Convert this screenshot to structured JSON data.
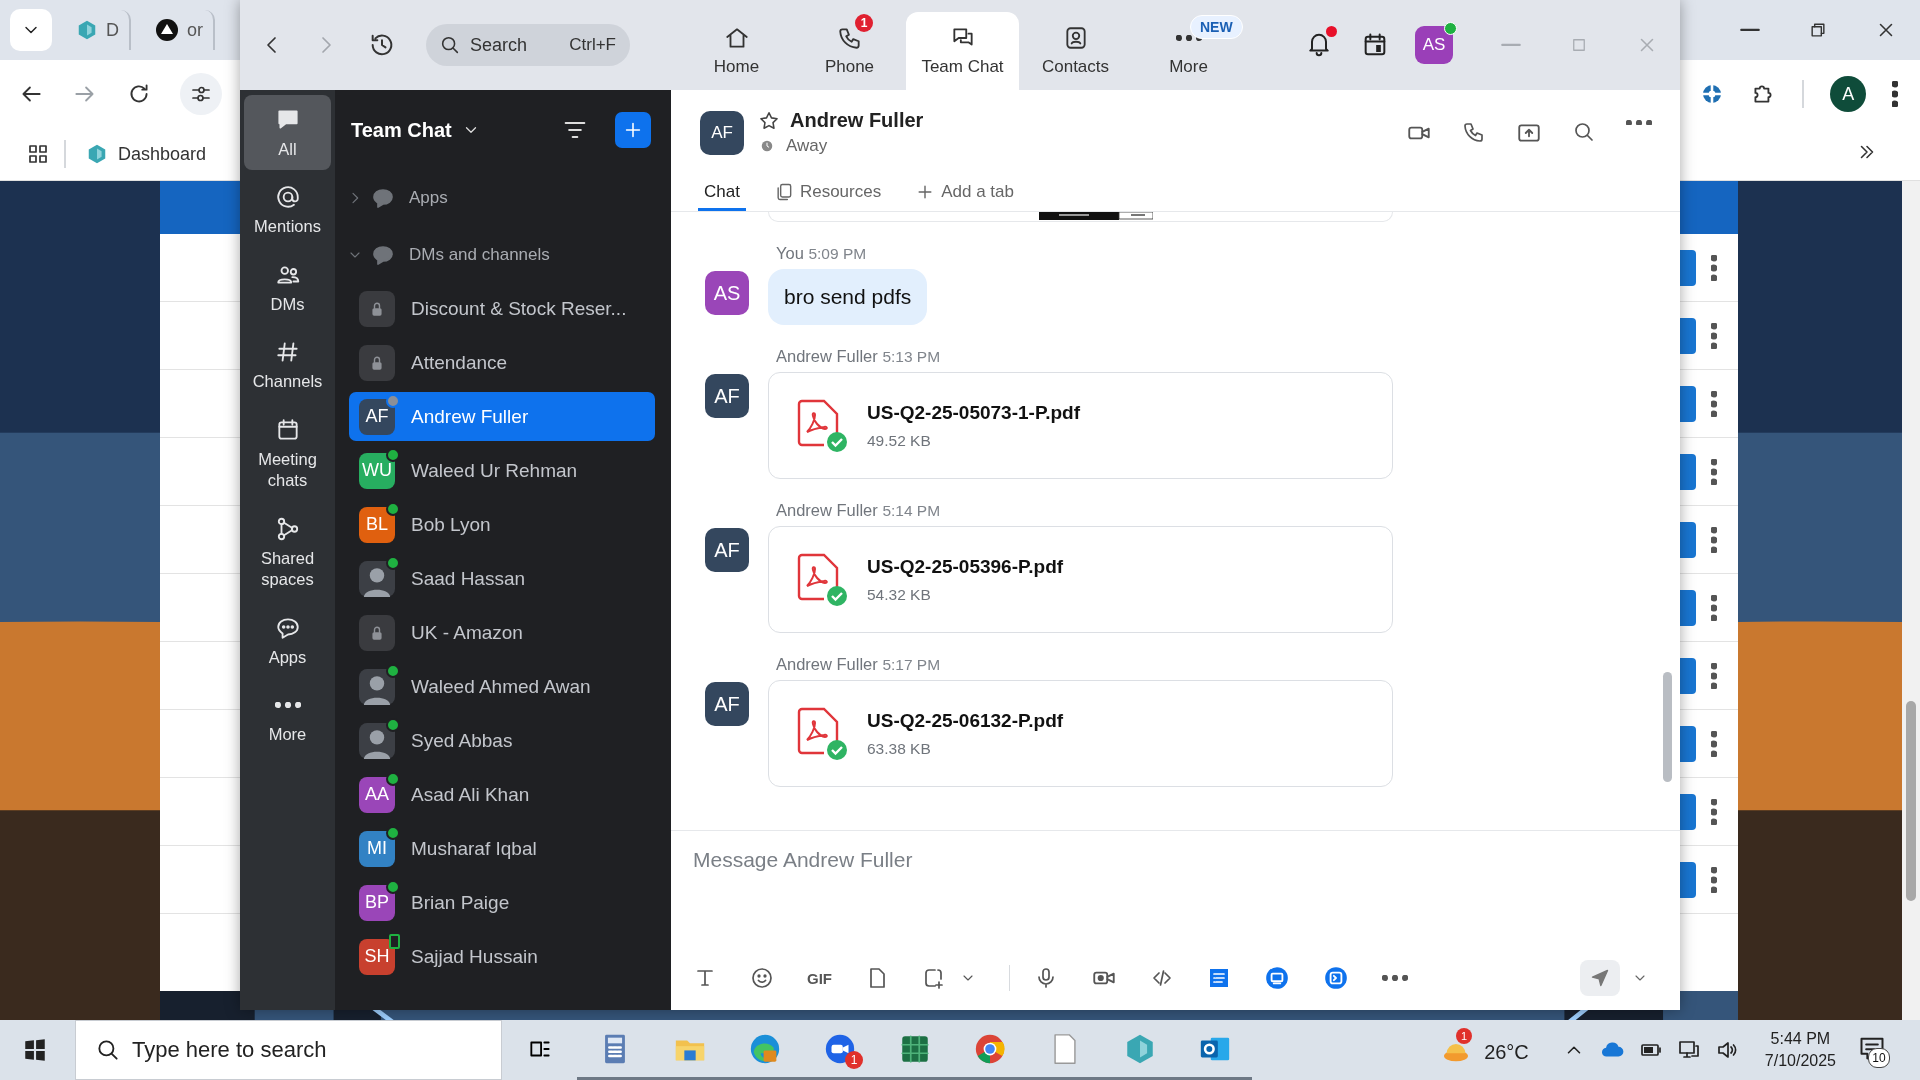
{
  "browser": {
    "tabs": [
      {
        "label": "D",
        "selected": false
      },
      {
        "label": "or",
        "selected": false
      }
    ],
    "bookmarks": [
      {
        "label": "Dashboard"
      }
    ],
    "profile": "A"
  },
  "zoom": {
    "search": {
      "placeholder": "Search",
      "shortcut": "Ctrl+F"
    },
    "tabs": [
      {
        "label": "Home",
        "selected": false
      },
      {
        "label": "Phone",
        "badge": "1",
        "selected": false
      },
      {
        "label": "Team Chat",
        "selected": true
      },
      {
        "label": "Contacts",
        "selected": false
      },
      {
        "label": "More",
        "tag": "NEW",
        "selected": false
      }
    ],
    "notifications": {
      "unread": true
    },
    "user": {
      "initials": "AS",
      "online": true
    },
    "rail": [
      {
        "label": "All",
        "selected": true
      },
      {
        "label": "Mentions",
        "selected": false
      },
      {
        "label": "DMs",
        "selected": false
      },
      {
        "label": "Channels",
        "selected": false
      },
      {
        "label": "Meeting chats",
        "selected": false
      },
      {
        "label": "Shared spaces",
        "selected": false
      },
      {
        "label": "Apps",
        "selected": false
      },
      {
        "label": "More",
        "selected": false
      }
    ],
    "sidebar": {
      "title": "Team Chat",
      "sections": [
        {
          "label": "Apps",
          "expanded": false
        },
        {
          "label": "DMs and channels",
          "expanded": true,
          "children": [
            {
              "kind": "channel",
              "name": "Discount & Stock Reser...",
              "online": false,
              "away": false,
              "mobile": false,
              "selected": false
            },
            {
              "kind": "channel",
              "name": "Attendance",
              "online": false,
              "away": false,
              "mobile": false,
              "selected": false
            },
            {
              "kind": "person",
              "name": "Andrew Fuller",
              "initials": "AF",
              "color": "#34475e",
              "online": false,
              "away": true,
              "mobile": false,
              "selected": true
            },
            {
              "kind": "person",
              "name": "Waleed Ur Rehman",
              "initials": "WU",
              "color": "#27ae60",
              "online": true,
              "away": false,
              "mobile": false,
              "selected": false
            },
            {
              "kind": "person",
              "name": "Bob Lyon",
              "initials": "BL",
              "color": "#e0600f",
              "online": true,
              "away": false,
              "mobile": false,
              "selected": false
            },
            {
              "name": "Saad Hassan",
              "online": true,
              "away": false,
              "mobile": false,
              "selected": false
            },
            {
              "kind": "channel",
              "name": "UK - Amazon",
              "online": false,
              "away": false,
              "mobile": false,
              "selected": false
            },
            {
              "name": "Waleed Ahmed Awan",
              "online": true,
              "away": false,
              "mobile": false,
              "selected": false
            },
            {
              "name": "Syed Abbas",
              "online": true,
              "away": false,
              "mobile": false,
              "selected": false
            },
            {
              "kind": "person",
              "name": "Asad Ali Khan",
              "initials": "AA",
              "color": "#9a46b8",
              "online": true,
              "away": false,
              "mobile": false,
              "selected": false
            },
            {
              "kind": "person",
              "name": "Musharaf Iqbal",
              "initials": "MI",
              "color": "#3282c4",
              "online": true,
              "away": false,
              "mobile": false,
              "selected": false
            },
            {
              "kind": "person",
              "name": "Brian Paige",
              "initials": "BP",
              "color": "#9a46b8",
              "online": true,
              "away": false,
              "mobile": false,
              "selected": false
            },
            {
              "kind": "person",
              "name": "Sajjad Hussain",
              "initials": "SH",
              "color": "#c8402e",
              "online": false,
              "away": false,
              "mobile": true,
              "selected": false
            }
          ]
        }
      ]
    },
    "chat": {
      "contact": {
        "initials": "AF",
        "name": "Andrew Fuller",
        "status": "Away",
        "favorite": false
      },
      "tabs": [
        {
          "label": "Chat",
          "selected": true
        },
        {
          "label": "Resources",
          "selected": false
        },
        {
          "label": "Add a tab",
          "selected": false
        }
      ],
      "messages": [
        {
          "kind": "picture"
        },
        {
          "kind": "text",
          "sender": "You",
          "time": "5:09 PM",
          "initials": "AS",
          "color": "#9a46b8",
          "text": "bro send pdfs"
        },
        {
          "kind": "file",
          "sender": "Andrew Fuller",
          "time": "5:13 PM",
          "initials": "AF",
          "color": "#34475e",
          "file": "US-Q2-25-05073-1-P.pdf",
          "size": "49.52 KB"
        },
        {
          "kind": "file",
          "sender": "Andrew Fuller",
          "time": "5:14 PM",
          "initials": "AF",
          "color": "#34475e",
          "file": "US-Q2-25-05396-P.pdf",
          "size": "54.32 KB"
        },
        {
          "kind": "file",
          "sender": "Andrew Fuller",
          "time": "5:17 PM",
          "initials": "AF",
          "color": "#34475e",
          "file": "US-Q2-25-06132-P.pdf",
          "size": "63.38 KB"
        }
      ]
    },
    "composer": {
      "placeholder": "Message Andrew Fuller",
      "gif": "GIF"
    }
  },
  "taskbar": {
    "search": {
      "placeholder": "Type here to search"
    },
    "apps": [
      {
        "running": false
      },
      {
        "running": true
      },
      {
        "running": true
      },
      {
        "running": true
      },
      {
        "running": true,
        "badge": "1"
      },
      {
        "running": true
      },
      {
        "running": true
      },
      {
        "running": true
      },
      {
        "running": true
      },
      {
        "running": true
      }
    ],
    "weather": {
      "temp": "26°C",
      "badge": "1"
    },
    "time": "5:44 PM",
    "date": "7/10/2025",
    "notifications": "10"
  }
}
